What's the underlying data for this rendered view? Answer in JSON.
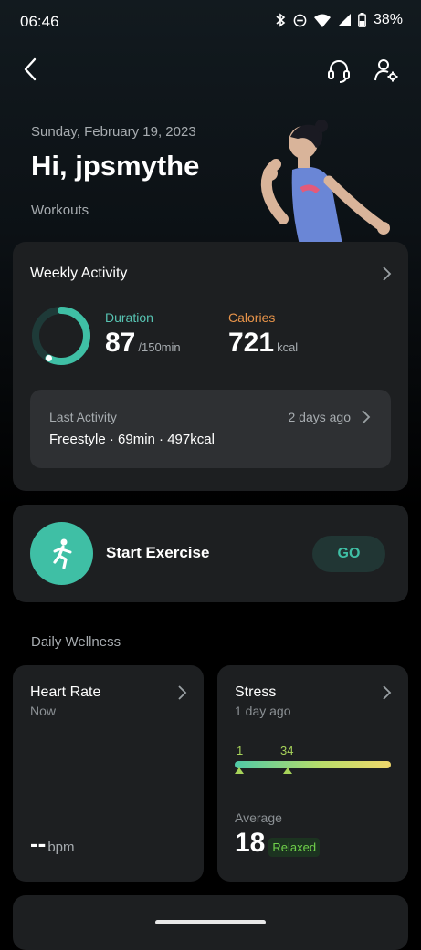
{
  "status_bar": {
    "time": "06:46",
    "battery": "38%"
  },
  "header": {
    "date": "Sunday, February 19, 2023",
    "greeting": "Hi, jpsmythe",
    "subtitle": "Workouts"
  },
  "weekly_activity": {
    "title": "Weekly Activity",
    "duration_label": "Duration",
    "duration_value": "87",
    "duration_unit": "/150min",
    "duration_progress": 0.58,
    "calories_label": "Calories",
    "calories_value": "721",
    "calories_unit": "kcal",
    "last_activity": {
      "label": "Last Activity",
      "when": "2 days ago",
      "details": "Freestyle · 69min · 497kcal"
    }
  },
  "start_exercise": {
    "label": "Start Exercise",
    "go": "GO"
  },
  "daily_wellness": {
    "title": "Daily Wellness",
    "heart_rate": {
      "title": "Heart Rate",
      "time": "Now",
      "value": "--",
      "unit": "bpm"
    },
    "stress": {
      "title": "Stress",
      "time": "1 day ago",
      "marker_min": "1",
      "marker_val": "34",
      "average_label": "Average",
      "average_value": "18",
      "status": "Relaxed"
    }
  },
  "colors": {
    "accent": "#3fbfa5",
    "duration": "#57c3b2",
    "calories": "#e8944a",
    "card": "#1d1f21",
    "relaxed_text": "#6fd14a",
    "relaxed_bg": "#1c3320"
  }
}
